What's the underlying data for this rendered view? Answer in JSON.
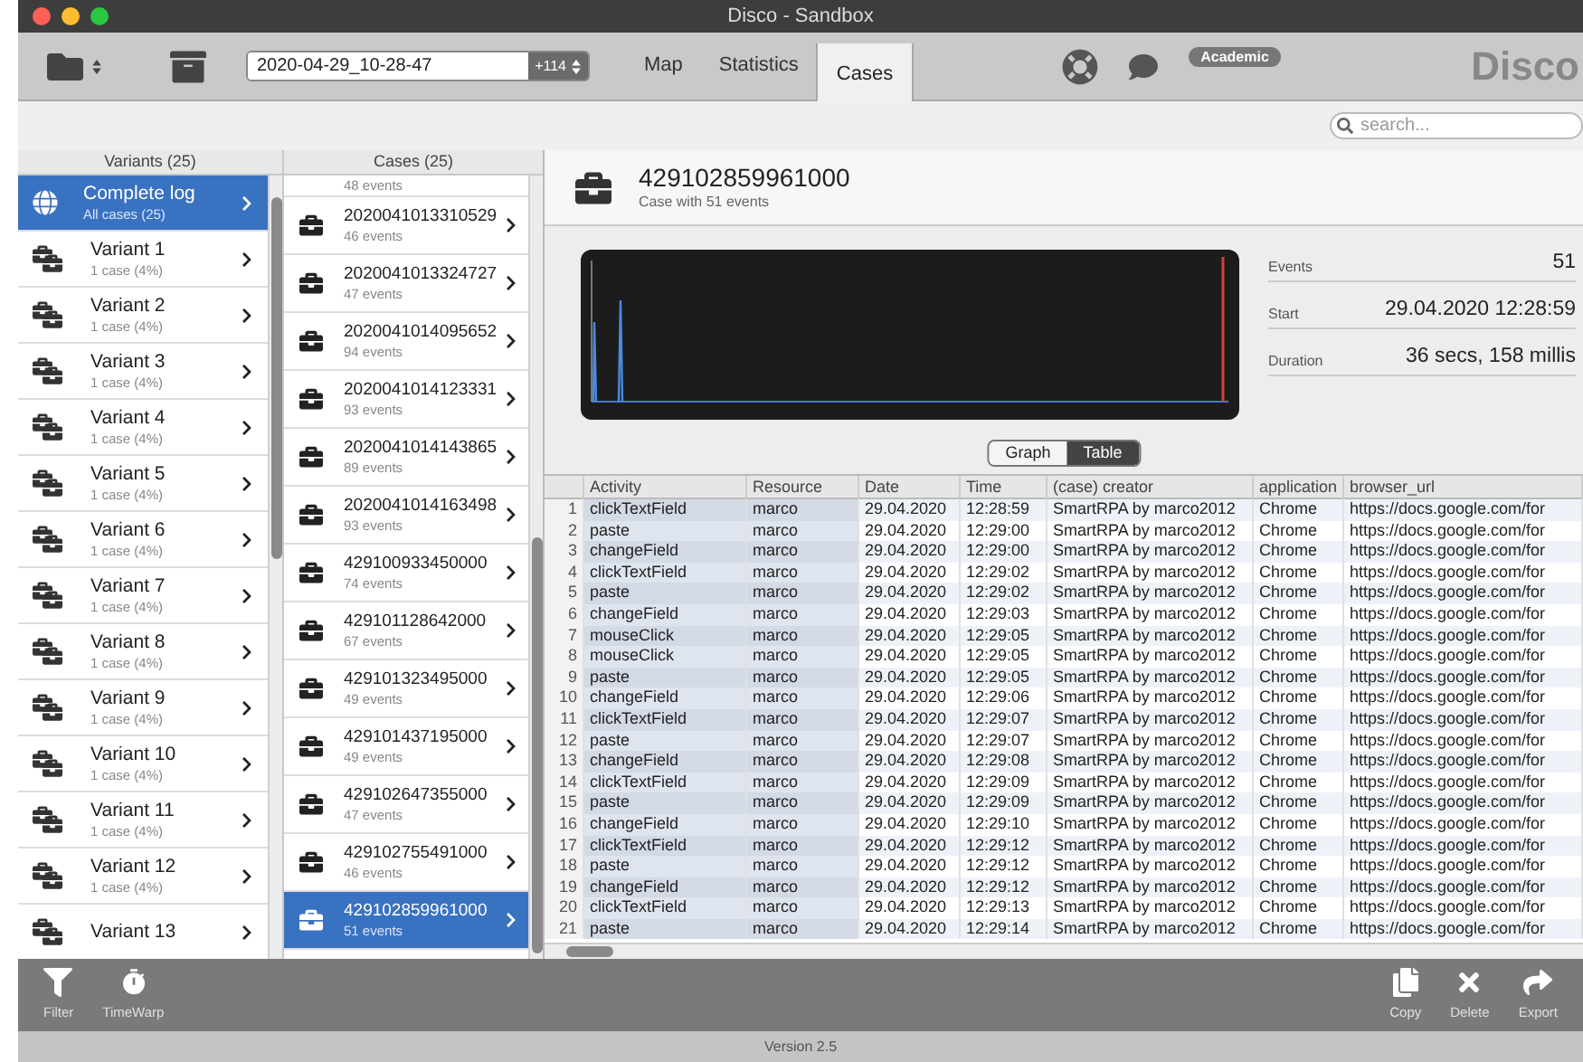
{
  "window": {
    "title": "Disco - Sandbox"
  },
  "toolbar": {
    "dataset": "2020-04-29_10-28-47",
    "dataset_count": "+114",
    "tabs": [
      {
        "label": "Map",
        "selected": false
      },
      {
        "label": "Statistics",
        "selected": false
      },
      {
        "label": "Cases",
        "selected": true
      }
    ],
    "badge": "Academic",
    "logo": "Disco"
  },
  "search": {
    "placeholder": "search..."
  },
  "variants": {
    "header": "Variants (25)",
    "items": [
      {
        "kind": "log",
        "title": "Complete log",
        "subtitle": "All cases (25)",
        "selected": true
      },
      {
        "kind": "variant",
        "title": "Variant 1",
        "subtitle": "1 case (4%)",
        "selected": false
      },
      {
        "kind": "variant",
        "title": "Variant 2",
        "subtitle": "1 case (4%)",
        "selected": false
      },
      {
        "kind": "variant",
        "title": "Variant 3",
        "subtitle": "1 case (4%)",
        "selected": false
      },
      {
        "kind": "variant",
        "title": "Variant 4",
        "subtitle": "1 case (4%)",
        "selected": false
      },
      {
        "kind": "variant",
        "title": "Variant 5",
        "subtitle": "1 case (4%)",
        "selected": false
      },
      {
        "kind": "variant",
        "title": "Variant 6",
        "subtitle": "1 case (4%)",
        "selected": false
      },
      {
        "kind": "variant",
        "title": "Variant 7",
        "subtitle": "1 case (4%)",
        "selected": false
      },
      {
        "kind": "variant",
        "title": "Variant 8",
        "subtitle": "1 case (4%)",
        "selected": false
      },
      {
        "kind": "variant",
        "title": "Variant 9",
        "subtitle": "1 case (4%)",
        "selected": false
      },
      {
        "kind": "variant",
        "title": "Variant 10",
        "subtitle": "1 case (4%)",
        "selected": false
      },
      {
        "kind": "variant",
        "title": "Variant 11",
        "subtitle": "1 case (4%)",
        "selected": false
      },
      {
        "kind": "variant",
        "title": "Variant 12",
        "subtitle": "1 case (4%)",
        "selected": false
      },
      {
        "kind": "variant",
        "title": "Variant 13",
        "selected": false
      }
    ]
  },
  "cases": {
    "header": "Cases (25)",
    "items": [
      {
        "events": "48 events",
        "selected": false
      },
      {
        "id": "2020041013310529",
        "events": "46 events",
        "selected": false
      },
      {
        "id": "2020041013324727",
        "events": "47 events",
        "selected": false
      },
      {
        "id": "2020041014095652",
        "events": "94 events",
        "selected": false
      },
      {
        "id": "2020041014123331",
        "events": "93 events",
        "selected": false
      },
      {
        "id": "2020041014143865",
        "events": "89 events",
        "selected": false
      },
      {
        "id": "2020041014163498",
        "events": "93 events",
        "selected": false
      },
      {
        "id": "429100933450000",
        "events": "74 events",
        "selected": false
      },
      {
        "id": "429101128642000",
        "events": "67 events",
        "selected": false
      },
      {
        "id": "429101323495000",
        "events": "49 events",
        "selected": false
      },
      {
        "id": "429101437195000",
        "events": "49 events",
        "selected": false
      },
      {
        "id": "429102647355000",
        "events": "47 events",
        "selected": false
      },
      {
        "id": "429102755491000",
        "events": "46 events",
        "selected": false
      },
      {
        "id": "429102859961000",
        "events": "51 events",
        "selected": true
      }
    ]
  },
  "case": {
    "title": "429102859961000",
    "subtitle": "Case with 51 events",
    "stats": [
      {
        "label": "Events",
        "value": "51"
      },
      {
        "label": "Start",
        "value": "29.04.2020 12:28:59"
      },
      {
        "label": "Duration",
        "value": "36 secs, 158 millis"
      }
    ],
    "views": [
      {
        "label": "Graph",
        "selected": false
      },
      {
        "label": "Table",
        "selected": true
      }
    ]
  },
  "table": {
    "columns": [
      "Activity",
      "Resource",
      "Date",
      "Time",
      "(case) creator",
      "application",
      "browser_url"
    ],
    "rows": [
      {
        "n": "1",
        "cells": [
          "clickTextField",
          "marco",
          "29.04.2020",
          "12:28:59",
          "SmartRPA by marco2012",
          "Chrome",
          "https://docs.google.com/for"
        ]
      },
      {
        "n": "2",
        "cells": [
          "paste",
          "marco",
          "29.04.2020",
          "12:29:00",
          "SmartRPA by marco2012",
          "Chrome",
          "https://docs.google.com/for"
        ]
      },
      {
        "n": "3",
        "cells": [
          "changeField",
          "marco",
          "29.04.2020",
          "12:29:00",
          "SmartRPA by marco2012",
          "Chrome",
          "https://docs.google.com/for"
        ]
      },
      {
        "n": "4",
        "cells": [
          "clickTextField",
          "marco",
          "29.04.2020",
          "12:29:02",
          "SmartRPA by marco2012",
          "Chrome",
          "https://docs.google.com/for"
        ]
      },
      {
        "n": "5",
        "cells": [
          "paste",
          "marco",
          "29.04.2020",
          "12:29:02",
          "SmartRPA by marco2012",
          "Chrome",
          "https://docs.google.com/for"
        ]
      },
      {
        "n": "6",
        "cells": [
          "changeField",
          "marco",
          "29.04.2020",
          "12:29:03",
          "SmartRPA by marco2012",
          "Chrome",
          "https://docs.google.com/for"
        ]
      },
      {
        "n": "7",
        "cells": [
          "mouseClick",
          "marco",
          "29.04.2020",
          "12:29:05",
          "SmartRPA by marco2012",
          "Chrome",
          "https://docs.google.com/for"
        ]
      },
      {
        "n": "8",
        "cells": [
          "mouseClick",
          "marco",
          "29.04.2020",
          "12:29:05",
          "SmartRPA by marco2012",
          "Chrome",
          "https://docs.google.com/for"
        ]
      },
      {
        "n": "9",
        "cells": [
          "paste",
          "marco",
          "29.04.2020",
          "12:29:05",
          "SmartRPA by marco2012",
          "Chrome",
          "https://docs.google.com/for"
        ]
      },
      {
        "n": "10",
        "cells": [
          "changeField",
          "marco",
          "29.04.2020",
          "12:29:06",
          "SmartRPA by marco2012",
          "Chrome",
          "https://docs.google.com/for"
        ]
      },
      {
        "n": "11",
        "cells": [
          "clickTextField",
          "marco",
          "29.04.2020",
          "12:29:07",
          "SmartRPA by marco2012",
          "Chrome",
          "https://docs.google.com/for"
        ]
      },
      {
        "n": "12",
        "cells": [
          "paste",
          "marco",
          "29.04.2020",
          "12:29:07",
          "SmartRPA by marco2012",
          "Chrome",
          "https://docs.google.com/for"
        ]
      },
      {
        "n": "13",
        "cells": [
          "changeField",
          "marco",
          "29.04.2020",
          "12:29:08",
          "SmartRPA by marco2012",
          "Chrome",
          "https://docs.google.com/for"
        ]
      },
      {
        "n": "14",
        "cells": [
          "clickTextField",
          "marco",
          "29.04.2020",
          "12:29:09",
          "SmartRPA by marco2012",
          "Chrome",
          "https://docs.google.com/for"
        ]
      },
      {
        "n": "15",
        "cells": [
          "paste",
          "marco",
          "29.04.2020",
          "12:29:09",
          "SmartRPA by marco2012",
          "Chrome",
          "https://docs.google.com/for"
        ]
      },
      {
        "n": "16",
        "cells": [
          "changeField",
          "marco",
          "29.04.2020",
          "12:29:10",
          "SmartRPA by marco2012",
          "Chrome",
          "https://docs.google.com/for"
        ]
      },
      {
        "n": "17",
        "cells": [
          "clickTextField",
          "marco",
          "29.04.2020",
          "12:29:12",
          "SmartRPA by marco2012",
          "Chrome",
          "https://docs.google.com/for"
        ]
      },
      {
        "n": "18",
        "cells": [
          "paste",
          "marco",
          "29.04.2020",
          "12:29:12",
          "SmartRPA by marco2012",
          "Chrome",
          "https://docs.google.com/for"
        ]
      },
      {
        "n": "19",
        "cells": [
          "changeField",
          "marco",
          "29.04.2020",
          "12:29:12",
          "SmartRPA by marco2012",
          "Chrome",
          "https://docs.google.com/for"
        ]
      },
      {
        "n": "20",
        "cells": [
          "clickTextField",
          "marco",
          "29.04.2020",
          "12:29:13",
          "SmartRPA by marco2012",
          "Chrome",
          "https://docs.google.com/for"
        ]
      },
      {
        "n": "21",
        "cells": [
          "paste",
          "marco",
          "29.04.2020",
          "12:29:14",
          "SmartRPA by marco2012",
          "Chrome",
          "https://docs.google.com/for"
        ]
      }
    ]
  },
  "bottom_toolbar": {
    "left": [
      {
        "kind": "filter",
        "label": "Filter"
      },
      {
        "kind": "timewarp",
        "label": "TimeWarp"
      }
    ],
    "right": [
      {
        "kind": "copy",
        "label": "Copy"
      },
      {
        "kind": "delete",
        "label": "Delete"
      },
      {
        "kind": "export",
        "label": "Export"
      }
    ]
  },
  "status_bar": "Version 2.5"
}
